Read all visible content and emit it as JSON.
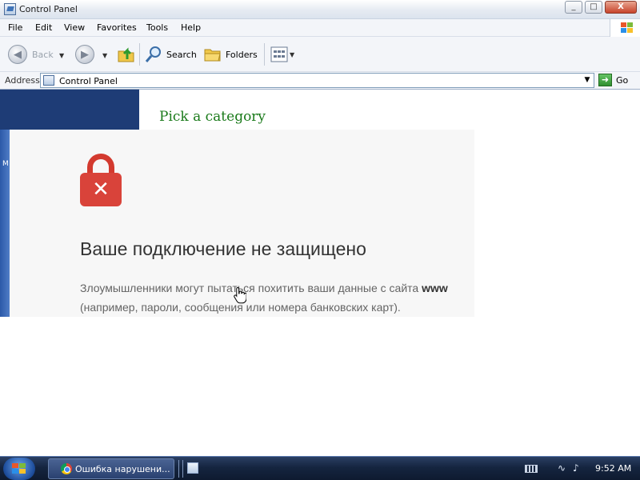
{
  "window": {
    "title": "Control Panel",
    "controls": {
      "minimize": "_",
      "maximize": "□",
      "close": "X"
    }
  },
  "menu": {
    "items": [
      "File",
      "Edit",
      "View",
      "Favorites",
      "Tools",
      "Help"
    ]
  },
  "toolbar": {
    "back_label": "Back",
    "search_label": "Search",
    "folders_label": "Folders"
  },
  "address": {
    "label": "Address",
    "value": "Control Panel",
    "go_label": "Go"
  },
  "control_panel": {
    "heading": "Pick a category",
    "sidebar_letter": "M"
  },
  "error_page": {
    "title": "Ваше подключение не защищено",
    "line1": "Злоумышленники могут пытаться похитить ваши данные с сайта ",
    "line1_bold": "www",
    "line2": "(например, пароли, сообщения или номера банковских карт).",
    "lock_color": "#d9433a"
  },
  "taskbar": {
    "task_label": "Ошибка нарушени...",
    "clock": "9:52 AM"
  },
  "icons": [
    "app-icon",
    "back-arrow-icon",
    "forward-arrow-icon",
    "up-folder-icon",
    "search-icon",
    "folders-icon",
    "views-icon",
    "go-icon",
    "lock-icon",
    "hand-cursor-icon",
    "windows-logo-icon",
    "chrome-icon",
    "keyboard-icon",
    "network-icon",
    "volume-icon"
  ]
}
